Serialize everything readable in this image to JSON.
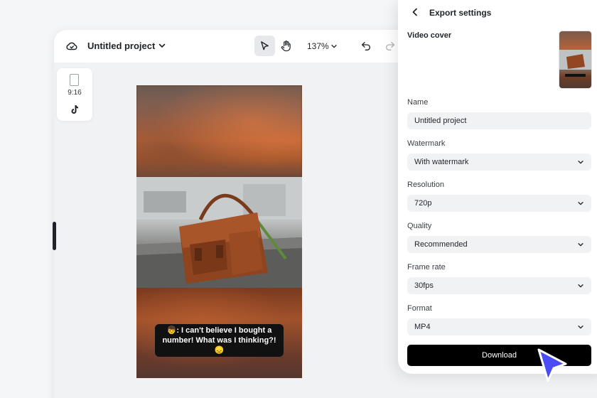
{
  "editor": {
    "project_title": "Untitled project",
    "zoom": "137%",
    "aspect_ratio": "9:16"
  },
  "video": {
    "caption": "👦: I can't believe I bought a number! What was I thinking?! 😞"
  },
  "export": {
    "title": "Export settings",
    "video_cover_label": "Video cover",
    "name_label": "Name",
    "name_value": "Untitled project",
    "watermark_label": "Watermark",
    "watermark_value": "With watermark",
    "resolution_label": "Resolution",
    "resolution_value": "720p",
    "quality_label": "Quality",
    "quality_value": "Recommended",
    "framerate_label": "Frame rate",
    "framerate_value": "30fps",
    "format_label": "Format",
    "format_value": "MP4",
    "download_label": "Download"
  },
  "icons": [
    "cloud-icon",
    "chevron-down-icon",
    "select-pointer-icon",
    "hand-icon",
    "undo-icon",
    "redo-icon",
    "tiktok-icon",
    "back-arrow-icon",
    "cursor-icon"
  ],
  "colors": {
    "download_bg": "#000000",
    "field_bg": "#f1f2f4",
    "cursor": "#4b4cf5"
  }
}
